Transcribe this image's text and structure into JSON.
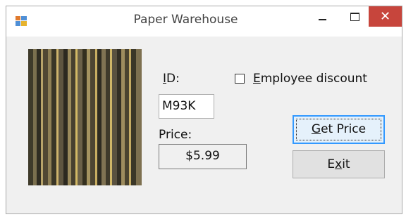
{
  "window": {
    "title": "Paper Warehouse",
    "minimize_glyph": "–",
    "close_glyph": "✕"
  },
  "form": {
    "id_label_u": "I",
    "id_label_rest": "D:",
    "id_value": "M93K",
    "price_label": "Price:",
    "price_value": "$5.99",
    "discount_label_u": "E",
    "discount_label_rest": "mployee discount",
    "discount_checked": false
  },
  "buttons": {
    "get_price_u": "G",
    "get_price_rest": "et Price",
    "exit_pre": "E",
    "exit_u": "x",
    "exit_post": "it"
  },
  "colors": {
    "close_button": "#c7453c",
    "focus_border": "#3399ff"
  }
}
